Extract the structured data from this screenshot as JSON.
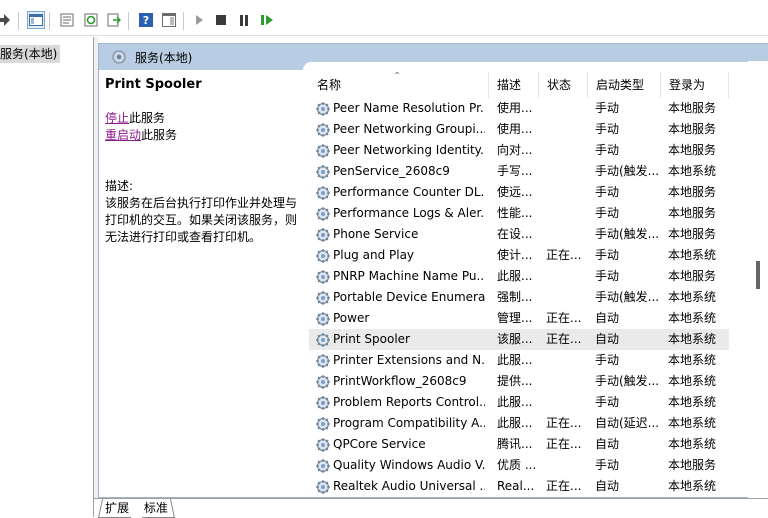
{
  "tree": {
    "selected_label": "服务(本地)"
  },
  "pane": {
    "header_title": "服务(本地)",
    "description": {
      "service_name": "Print Spooler",
      "stop_link": "停止",
      "stop_suffix": "此服务",
      "restart_link": "重启动",
      "restart_suffix": "此服务",
      "desc_label": "描述:",
      "desc_text": "该服务在后台执行打印作业并处理与打印机的交互。如果关闭该服务，则无法进行打印或查看打印机。"
    }
  },
  "columns": {
    "name": "名称",
    "desc": "描述",
    "status": "状态",
    "startup": "启动类型",
    "logon": "登录为"
  },
  "rows": [
    {
      "name": "Peer Name Resolution Pr...",
      "desc": "使用...",
      "status": "",
      "startup": "手动",
      "logon": "本地服务"
    },
    {
      "name": "Peer Networking Groupi...",
      "desc": "使用...",
      "status": "",
      "startup": "手动",
      "logon": "本地服务"
    },
    {
      "name": "Peer Networking Identity...",
      "desc": "向对...",
      "status": "",
      "startup": "手动",
      "logon": "本地服务"
    },
    {
      "name": "PenService_2608c9",
      "desc": "手写...",
      "status": "",
      "startup": "手动(触发...",
      "logon": "本地系统"
    },
    {
      "name": "Performance Counter DL...",
      "desc": "使远...",
      "status": "",
      "startup": "手动",
      "logon": "本地服务"
    },
    {
      "name": "Performance Logs & Aler...",
      "desc": "性能...",
      "status": "",
      "startup": "手动",
      "logon": "本地服务"
    },
    {
      "name": "Phone Service",
      "desc": "在设...",
      "status": "",
      "startup": "手动(触发...",
      "logon": "本地服务"
    },
    {
      "name": "Plug and Play",
      "desc": "使计...",
      "status": "正在...",
      "startup": "手动",
      "logon": "本地系统"
    },
    {
      "name": "PNRP Machine Name Pu...",
      "desc": "此服...",
      "status": "",
      "startup": "手动",
      "logon": "本地服务"
    },
    {
      "name": "Portable Device Enumera...",
      "desc": "强制...",
      "status": "",
      "startup": "手动(触发...",
      "logon": "本地系统"
    },
    {
      "name": "Power",
      "desc": "管理...",
      "status": "正在...",
      "startup": "自动",
      "logon": "本地系统"
    },
    {
      "name": "Print Spooler",
      "desc": "该服...",
      "status": "正在...",
      "startup": "自动",
      "logon": "本地系统"
    },
    {
      "name": "Printer Extensions and N...",
      "desc": "此服...",
      "status": "",
      "startup": "手动",
      "logon": "本地系统"
    },
    {
      "name": "PrintWorkflow_2608c9",
      "desc": "提供...",
      "status": "",
      "startup": "手动(触发...",
      "logon": "本地系统"
    },
    {
      "name": "Problem Reports Control...",
      "desc": "此服...",
      "status": "",
      "startup": "手动",
      "logon": "本地系统"
    },
    {
      "name": "Program Compatibility A...",
      "desc": "此服...",
      "status": "正在...",
      "startup": "自动(延迟...",
      "logon": "本地系统"
    },
    {
      "name": "QPCore Service",
      "desc": "腾讯...",
      "status": "正在...",
      "startup": "自动",
      "logon": "本地系统"
    },
    {
      "name": "Quality Windows Audio V...",
      "desc": "优质 ...",
      "status": "",
      "startup": "手动",
      "logon": "本地服务"
    },
    {
      "name": "Realtek Audio Universal ...",
      "desc": "Real...",
      "status": "正在...",
      "startup": "自动",
      "logon": "本地系统"
    }
  ],
  "bottom_tabs": {
    "extended": "扩展",
    "standard": "标准"
  },
  "colors": {
    "header_bg": "#b8cde3",
    "link": "#8b1a8b",
    "selected_row": "#eaeaea"
  }
}
